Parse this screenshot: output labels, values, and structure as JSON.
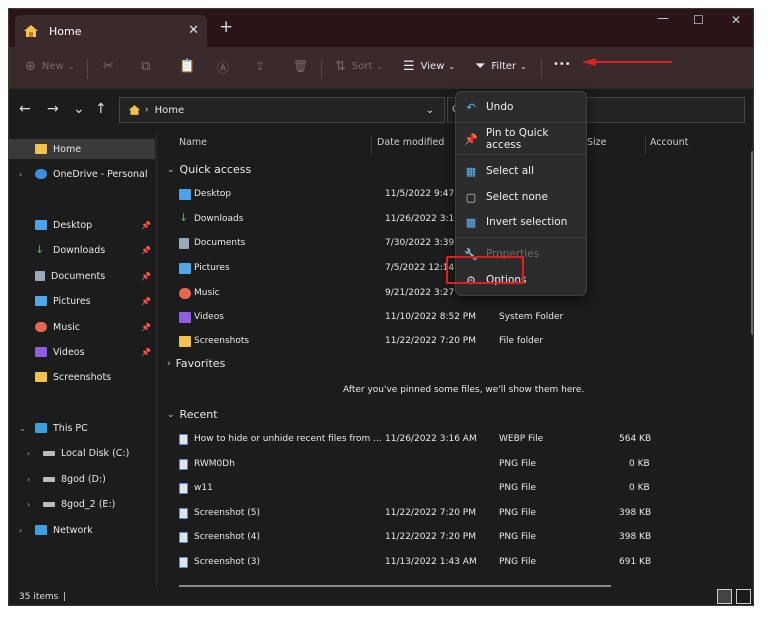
{
  "window": {
    "tab_title": "Home",
    "tab_close": "✕",
    "new_tab": "+",
    "minimize": "—",
    "maximize": "☐",
    "close": "✕"
  },
  "toolbar": {
    "new_label": "New",
    "sort_label": "Sort",
    "view_label": "View",
    "filter_label": "Filter",
    "more_label": "•••"
  },
  "navigation": {
    "back": "←",
    "forward": "→",
    "recent": "⌄",
    "up": "↑",
    "breadcrumb": "Home",
    "addr_dropdown": "⌄",
    "search_hint": "C"
  },
  "sidebar": {
    "items": [
      {
        "label": "Home",
        "icon": "home-icon"
      },
      {
        "label": "OneDrive - Personal",
        "icon": "cloud-icon"
      },
      {
        "label": "Desktop",
        "icon": "desktop-icon"
      },
      {
        "label": "Downloads",
        "icon": "download-icon"
      },
      {
        "label": "Documents",
        "icon": "document-icon"
      },
      {
        "label": "Pictures",
        "icon": "pictures-icon"
      },
      {
        "label": "Music",
        "icon": "music-icon"
      },
      {
        "label": "Videos",
        "icon": "videos-icon"
      },
      {
        "label": "Screenshots",
        "icon": "folder-icon"
      },
      {
        "label": "This PC",
        "icon": "pc-icon"
      },
      {
        "label": "Local Disk (C:)",
        "icon": "drive-icon"
      },
      {
        "label": "8god (D:)",
        "icon": "drive-icon"
      },
      {
        "label": "8god_2 (E:)",
        "icon": "drive-icon"
      },
      {
        "label": "Network",
        "icon": "network-icon"
      }
    ]
  },
  "columns": {
    "name": "Name",
    "date": "Date modified",
    "size": "Size",
    "account": "Account"
  },
  "groups": {
    "quick_access": "Quick access",
    "favorites": "Favorites",
    "recent": "Recent",
    "favorites_empty": "After you've pinned some files, we'll show them here."
  },
  "quick_access": [
    {
      "name": "Desktop",
      "date": "11/5/2022 9:47 P",
      "type": "",
      "icon_color": "#4aa3e8"
    },
    {
      "name": "Downloads",
      "date": "11/26/2022 3:16",
      "type": "",
      "icon_color": "#3fbf6f"
    },
    {
      "name": "Documents",
      "date": "7/30/2022 3:39 P",
      "type": "",
      "icon_color": "#9aa8b8"
    },
    {
      "name": "Pictures",
      "date": "7/5/2022 12:14 A",
      "type": "",
      "icon_color": "#4fa9e8"
    },
    {
      "name": "Music",
      "date": "9/21/2022 3:27 P",
      "type": "",
      "icon_color": "#e8664f"
    },
    {
      "name": "Videos",
      "date": "11/10/2022 8:52 PM",
      "type": "System Folder",
      "icon_color": "#8e5fe0"
    },
    {
      "name": "Screenshots",
      "date": "11/22/2022 7:20 PM",
      "type": "File folder",
      "icon_color": "#f2c14e"
    }
  ],
  "recent": [
    {
      "name": "How to hide or unhide recent files from ...",
      "date": "11/26/2022 3:16 AM",
      "type": "WEBP File",
      "size": "564 KB"
    },
    {
      "name": "RWM0Dh",
      "date": "",
      "type": "PNG File",
      "size": "0 KB"
    },
    {
      "name": "w11",
      "date": "",
      "type": "PNG File",
      "size": "0 KB"
    },
    {
      "name": "Screenshot (5)",
      "date": "11/22/2022 7:20 PM",
      "type": "PNG File",
      "size": "398 KB"
    },
    {
      "name": "Screenshot (4)",
      "date": "11/22/2022 7:20 PM",
      "type": "PNG File",
      "size": "398 KB"
    },
    {
      "name": "Screenshot (3)",
      "date": "11/13/2022 1:43 AM",
      "type": "PNG File",
      "size": "691 KB"
    }
  ],
  "menu": {
    "undo": "Undo",
    "pin": "Pin to Quick access",
    "select_all": "Select all",
    "select_none": "Select none",
    "invert": "Invert selection",
    "properties": "Properties",
    "options": "Options"
  },
  "status": {
    "item_count": "35 items",
    "divider": "|"
  },
  "colors": {
    "accent": "#60b8ff",
    "highlight": "#e02020",
    "titlebar": "#2a1418",
    "toolbar": "#3b2a2c"
  }
}
